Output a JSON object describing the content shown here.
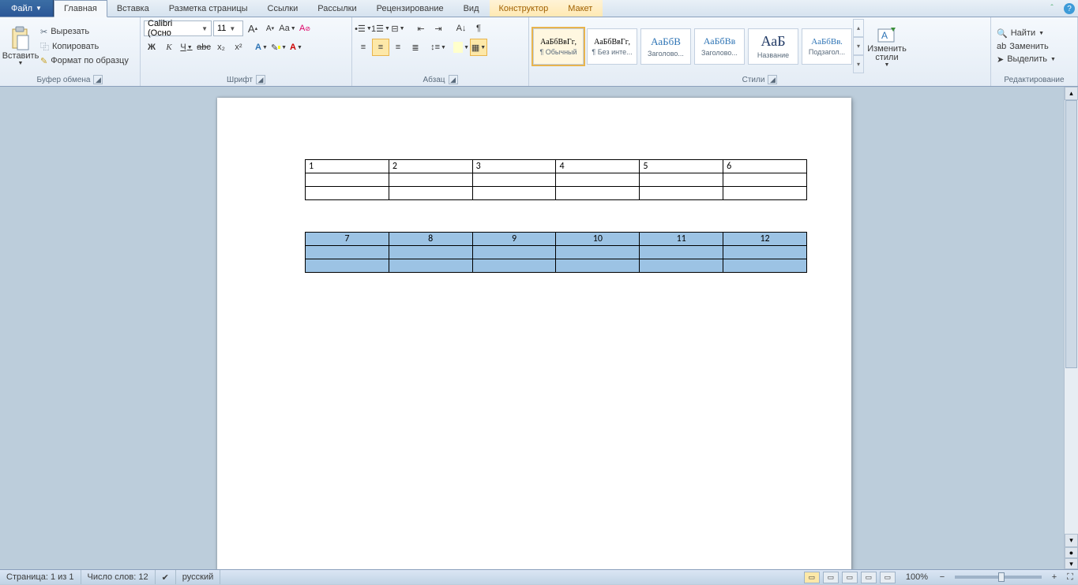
{
  "tabs": {
    "file": "Файл",
    "items": [
      "Главная",
      "Вставка",
      "Разметка страницы",
      "Ссылки",
      "Рассылки",
      "Рецензирование",
      "Вид",
      "Конструктор",
      "Макет"
    ],
    "active": 0,
    "context_start": 7
  },
  "ribbon": {
    "clipboard": {
      "label": "Буфер обмена",
      "paste": "Вставить",
      "cut": "Вырезать",
      "copy": "Копировать",
      "format_painter": "Формат по образцу"
    },
    "font": {
      "label": "Шрифт",
      "font_name": "Calibri (Осно",
      "font_size": "11",
      "bold": "Ж",
      "italic": "К",
      "underline": "Ч",
      "strike": "abc",
      "sub": "x₂",
      "sup": "x²",
      "grow": "A",
      "shrink": "A",
      "case": "Aa",
      "clear": "A"
    },
    "paragraph": {
      "label": "Абзац"
    },
    "styles": {
      "label": "Стили",
      "change": "Изменить\nстили",
      "tiles": [
        {
          "preview": "АаБбВвГг,",
          "name": "¶ Обычный",
          "sel": true,
          "color": "#000",
          "psize": "10px"
        },
        {
          "preview": "АаБбВвГг,",
          "name": "¶ Без инте...",
          "color": "#000",
          "psize": "10px"
        },
        {
          "preview": "АаБбВ",
          "name": "Заголово...",
          "color": "#2e74b5",
          "psize": "13px"
        },
        {
          "preview": "АаБбВв",
          "name": "Заголово...",
          "color": "#2e74b5",
          "psize": "12px"
        },
        {
          "preview": "АаБ",
          "name": "Название",
          "color": "#1f3864",
          "psize": "18px"
        },
        {
          "preview": "АаБбВв.",
          "name": "Подзагол...",
          "color": "#2e74b5",
          "psize": "11px"
        }
      ]
    },
    "editing": {
      "label": "Редактирование",
      "find": "Найти",
      "replace": "Заменить",
      "select": "Выделить"
    }
  },
  "document": {
    "table1": {
      "row1": [
        "1",
        "2",
        "3",
        "4",
        "5",
        "6"
      ],
      "rows_blank": 2
    },
    "table2": {
      "row1": [
        "7",
        "8",
        "9",
        "10",
        "11",
        "12"
      ],
      "rows_blank": 2
    }
  },
  "status": {
    "page": "Страница: 1 из 1",
    "words": "Число слов: 12",
    "lang": "русский",
    "zoom": "100%",
    "zoom_minus": "−",
    "zoom_plus": "+"
  }
}
